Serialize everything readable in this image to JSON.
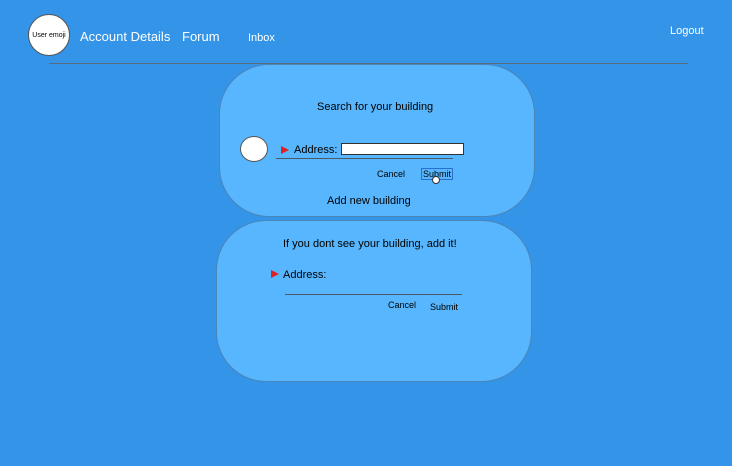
{
  "header": {
    "avatar_label": "User emoji",
    "nav": {
      "account": "Account Details",
      "forum": "Forum",
      "inbox": "Inbox",
      "logout": "Logout"
    }
  },
  "search_card": {
    "title": "Search for your building",
    "address_label": "Address:",
    "address_value": "",
    "cancel": "Cancel",
    "submit": "Submit",
    "add_new": "Add new building"
  },
  "add_card": {
    "title": "If you dont see your building, add it!",
    "address_label": "Address:",
    "cancel": "Cancel",
    "submit": "Submit"
  },
  "colors": {
    "background": "#3394e8",
    "card": "#57b6fd",
    "arrow": "#e02020"
  }
}
